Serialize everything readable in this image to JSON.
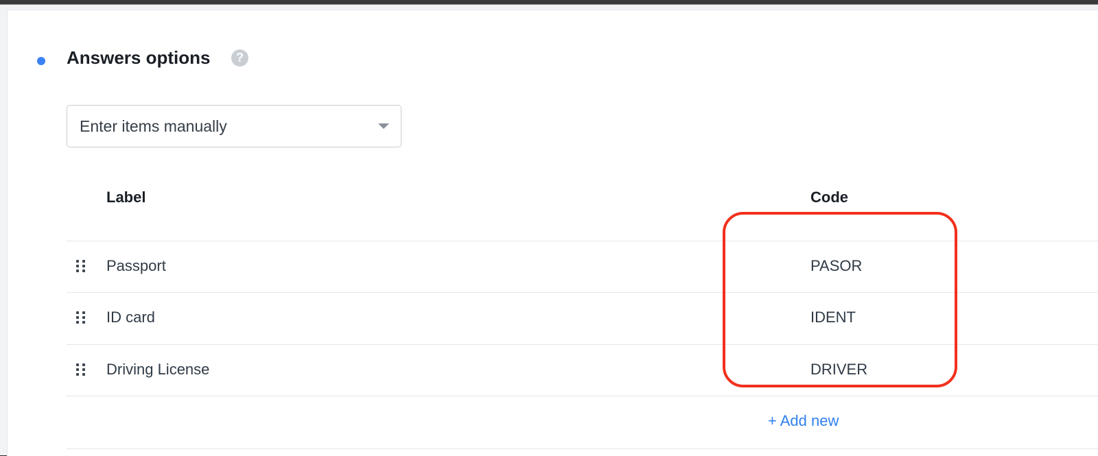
{
  "section": {
    "title": "Answers options",
    "help_icon": "question-circle-icon"
  },
  "source_select": {
    "value": "Enter items manually"
  },
  "table": {
    "headers": {
      "label": "Label",
      "code": "Code"
    },
    "rows": [
      {
        "label": "Passport",
        "code": "PASOR"
      },
      {
        "label": "ID card",
        "code": "IDENT"
      },
      {
        "label": "Driving License",
        "code": "DRIVER"
      }
    ],
    "add_new": "+ Add new"
  },
  "colors": {
    "accent": "#2f80ed",
    "bullet": "#3b82f6",
    "highlight": "#f2301d"
  }
}
